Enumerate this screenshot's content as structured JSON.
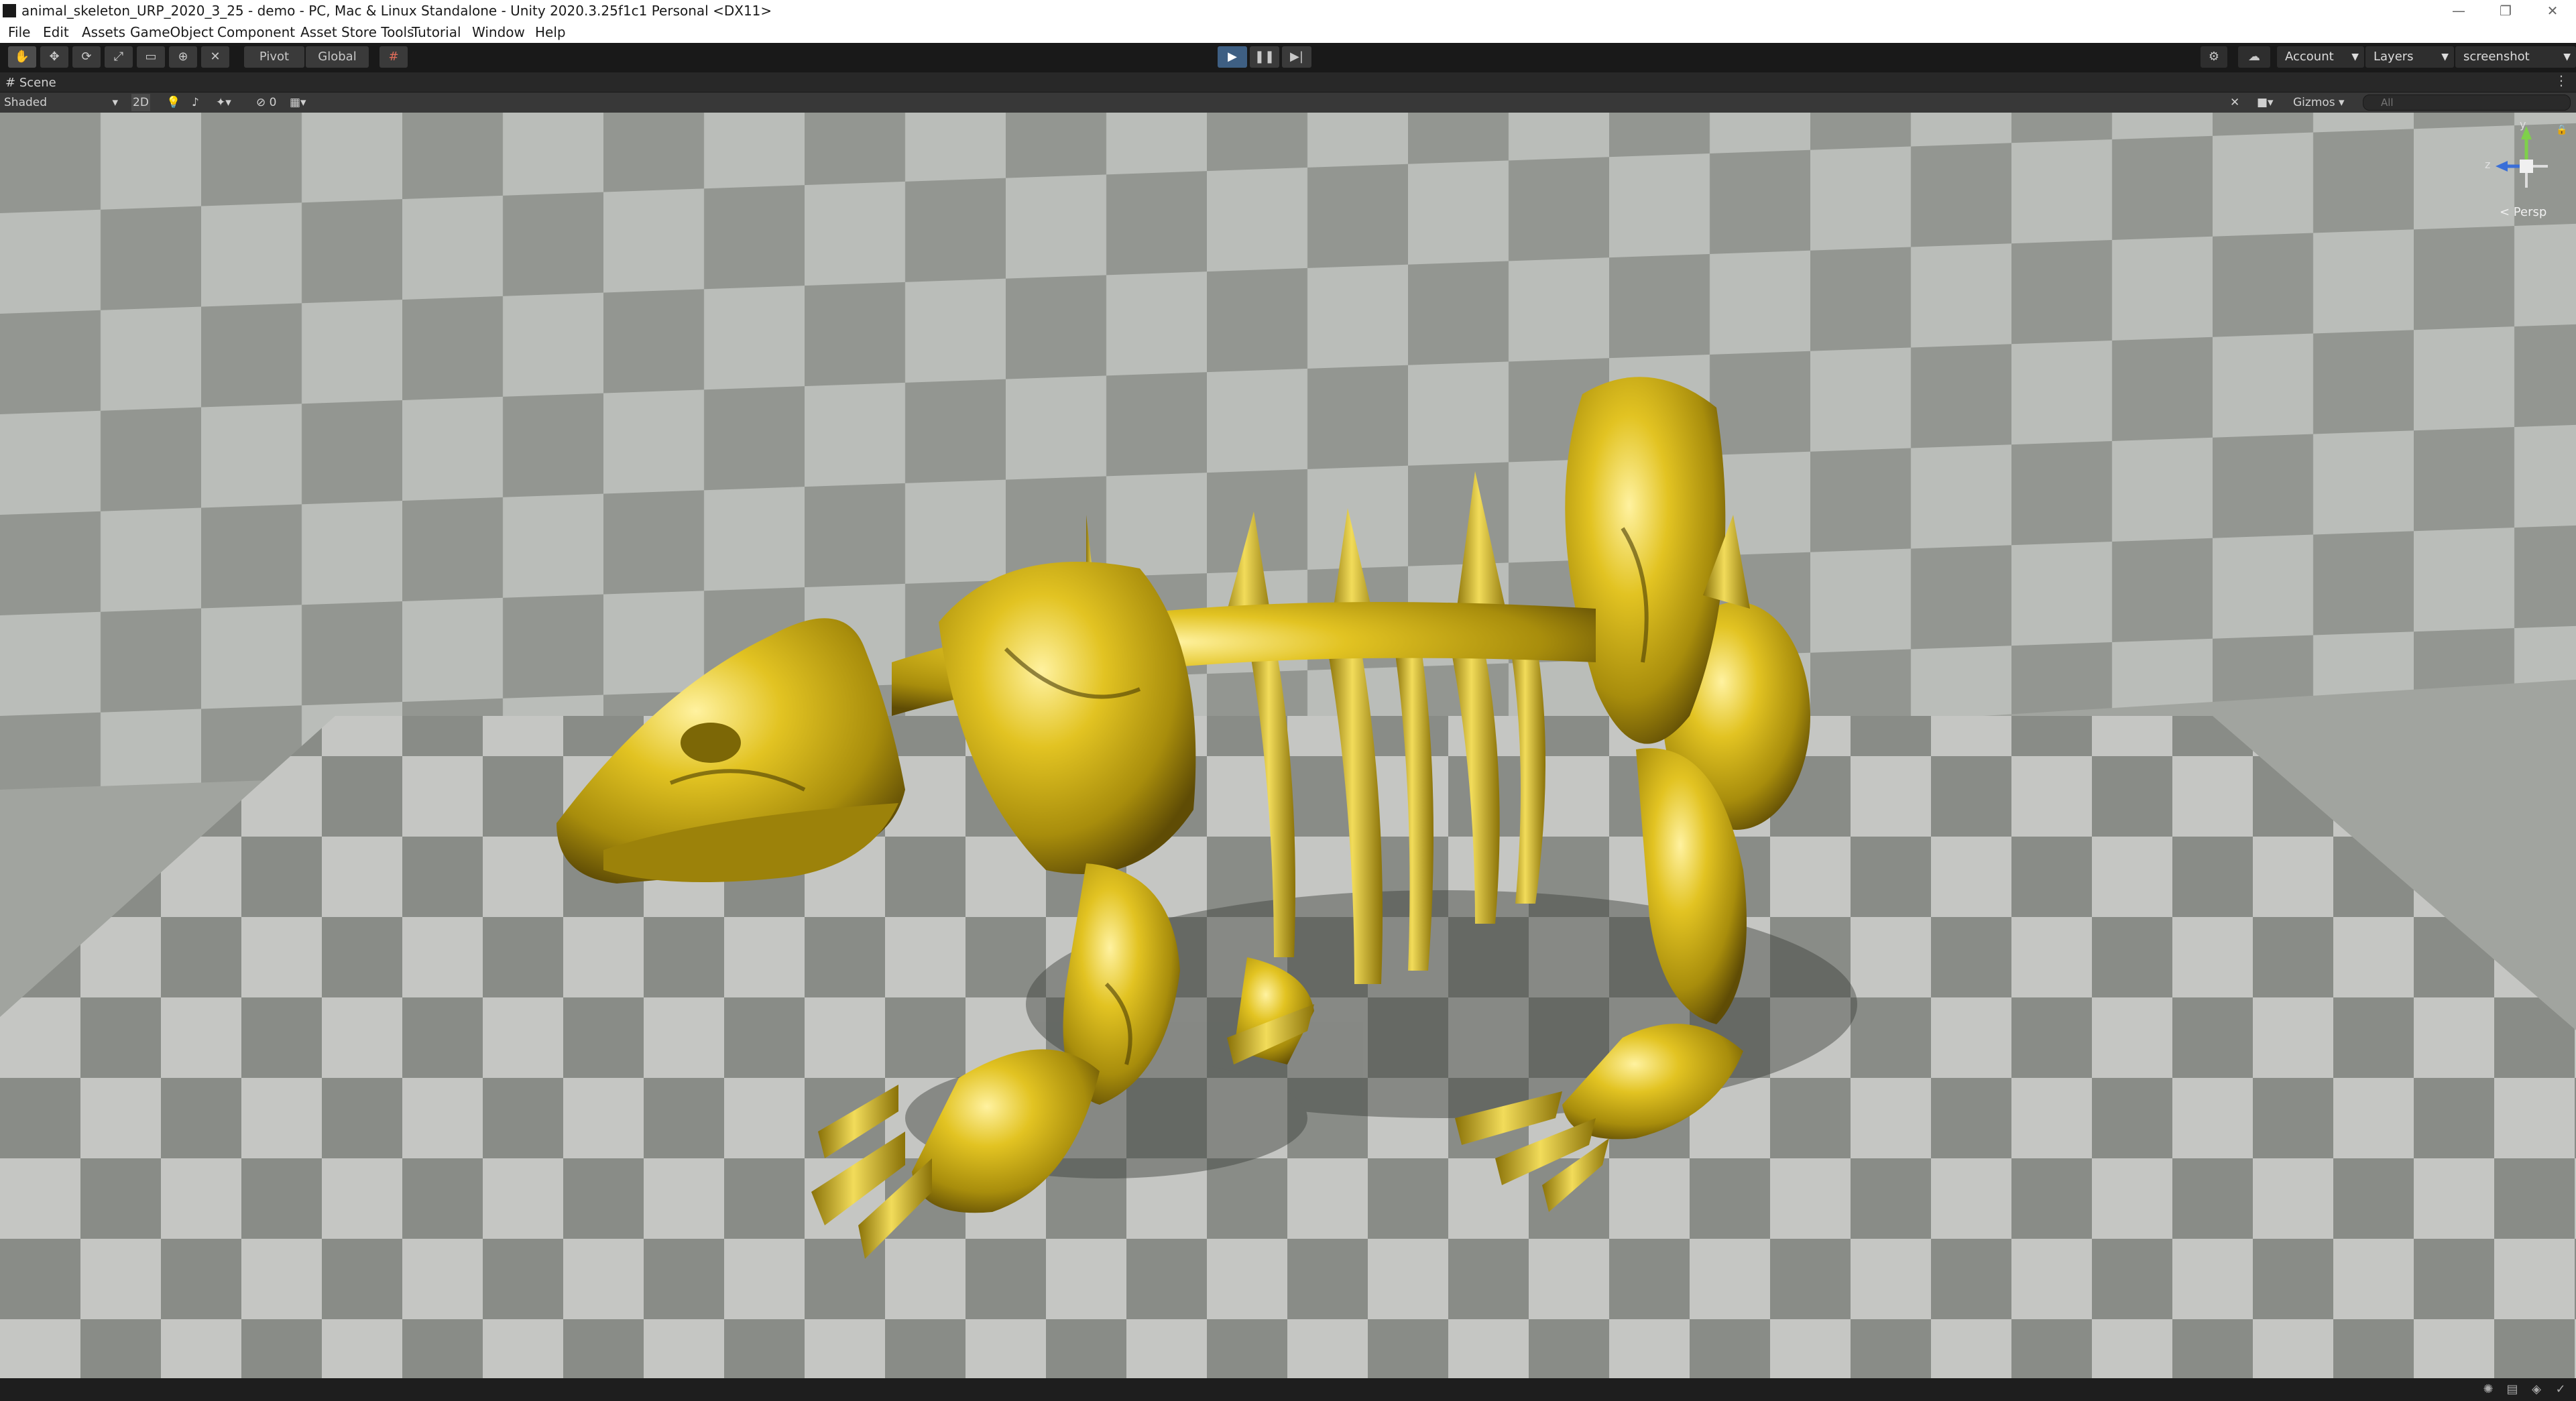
{
  "window": {
    "title": "animal_skeleton_URP_2020_3_25 - demo - PC, Mac & Linux Standalone - Unity 2020.3.25f1c1 Personal <DX11>",
    "controls": [
      "—",
      "❐",
      "✕"
    ]
  },
  "menu": [
    "File",
    "Edit",
    "Assets",
    "GameObject",
    "Component",
    "Asset Store Tools",
    "Tutorial",
    "Window",
    "Help"
  ],
  "toolbar": {
    "pivot_label": "Pivot",
    "global_label": "Global",
    "account_label": "Account",
    "layers_label": "Layers",
    "layout_label": "screenshot"
  },
  "scene_tab": {
    "label": "Scene"
  },
  "scene_bar": {
    "shading_mode": "Shaded",
    "mode_2d": "2D",
    "hidden_count": "0",
    "gizmos_label": "Gizmos",
    "search_placeholder": "All"
  },
  "gizmo": {
    "y_axis": "y",
    "z_axis": "z",
    "projection": "< Persp"
  },
  "colors": {
    "play_active": "#3e5f83",
    "skeleton_gold": "#d4b21a",
    "floor_light": "#c2c4c0",
    "floor_dark": "#7e827c"
  }
}
